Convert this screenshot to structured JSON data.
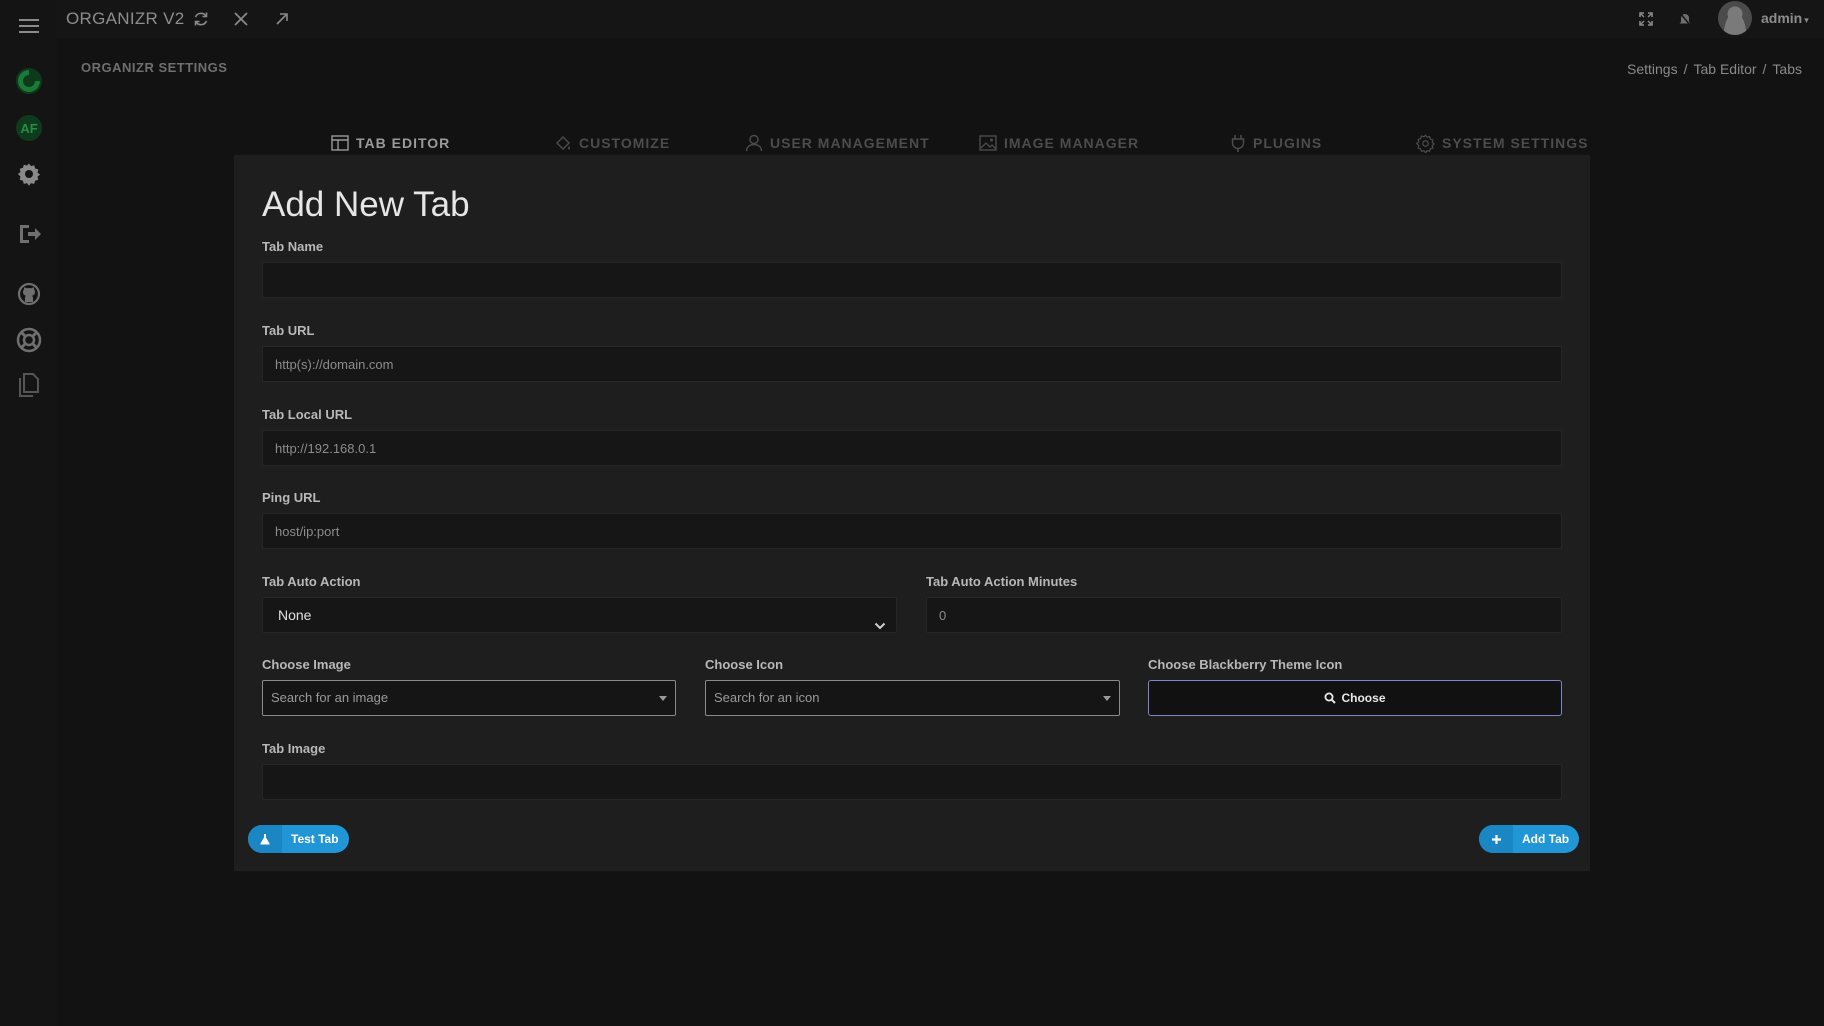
{
  "app": {
    "title": "ORGANIZR V2",
    "user": "admin"
  },
  "page": {
    "heading": "ORGANIZR SETTINGS",
    "breadcrumb": [
      "Settings",
      "Tab Editor",
      "Tabs"
    ]
  },
  "sidebar": {
    "items": [
      {
        "name": "menu-icon"
      },
      {
        "name": "organizr-logo-icon"
      },
      {
        "name": "app-logo-icon"
      },
      {
        "name": "gear-icon"
      },
      {
        "name": "logout-icon"
      },
      {
        "name": "github-icon"
      },
      {
        "name": "help-lifebuoy-icon"
      },
      {
        "name": "docs-icon"
      }
    ]
  },
  "topbar": {
    "icons": [
      "refresh-icon",
      "close-icon",
      "external-link-icon",
      "fullscreen-icon",
      "notifications-icon"
    ]
  },
  "tabs": [
    {
      "label": "TAB EDITOR",
      "icon": "tab-editor-icon",
      "active": true
    },
    {
      "label": "CUSTOMIZE",
      "icon": "paint-bucket-icon",
      "active": false
    },
    {
      "label": "USER MANAGEMENT",
      "icon": "user-icon",
      "active": false
    },
    {
      "label": "IMAGE MANAGER",
      "icon": "image-icon",
      "active": false
    },
    {
      "label": "PLUGINS",
      "icon": "plug-icon",
      "active": false
    },
    {
      "label": "SYSTEM SETTINGS",
      "icon": "gear-icon",
      "active": false
    }
  ],
  "form": {
    "title": "Add New Tab",
    "tab_name": {
      "label": "Tab Name",
      "value": "",
      "placeholder": ""
    },
    "tab_url": {
      "label": "Tab URL",
      "placeholder": "http(s)://domain.com"
    },
    "tab_local_url": {
      "label": "Tab Local URL",
      "placeholder": "http://192.168.0.1"
    },
    "ping_url": {
      "label": "Ping URL",
      "placeholder": "host/ip:port"
    },
    "tab_auto_action": {
      "label": "Tab Auto Action",
      "selected": "None"
    },
    "tab_auto_action_minutes": {
      "label": "Tab Auto Action Minutes",
      "placeholder": "0"
    },
    "choose_image": {
      "label": "Choose Image",
      "placeholder": "Search for an image"
    },
    "choose_icon": {
      "label": "Choose Icon",
      "placeholder": "Search for an icon"
    },
    "choose_bb_icon": {
      "label": "Choose Blackberry Theme Icon",
      "button": "Choose"
    },
    "tab_image": {
      "label": "Tab Image",
      "value": ""
    },
    "test_button": "Test Tab",
    "add_button": "Add Tab"
  },
  "colors": {
    "background": "#121212",
    "panel": "#1e1e1e",
    "accent": "#2196d6",
    "choose_border": "#7a86c8"
  }
}
